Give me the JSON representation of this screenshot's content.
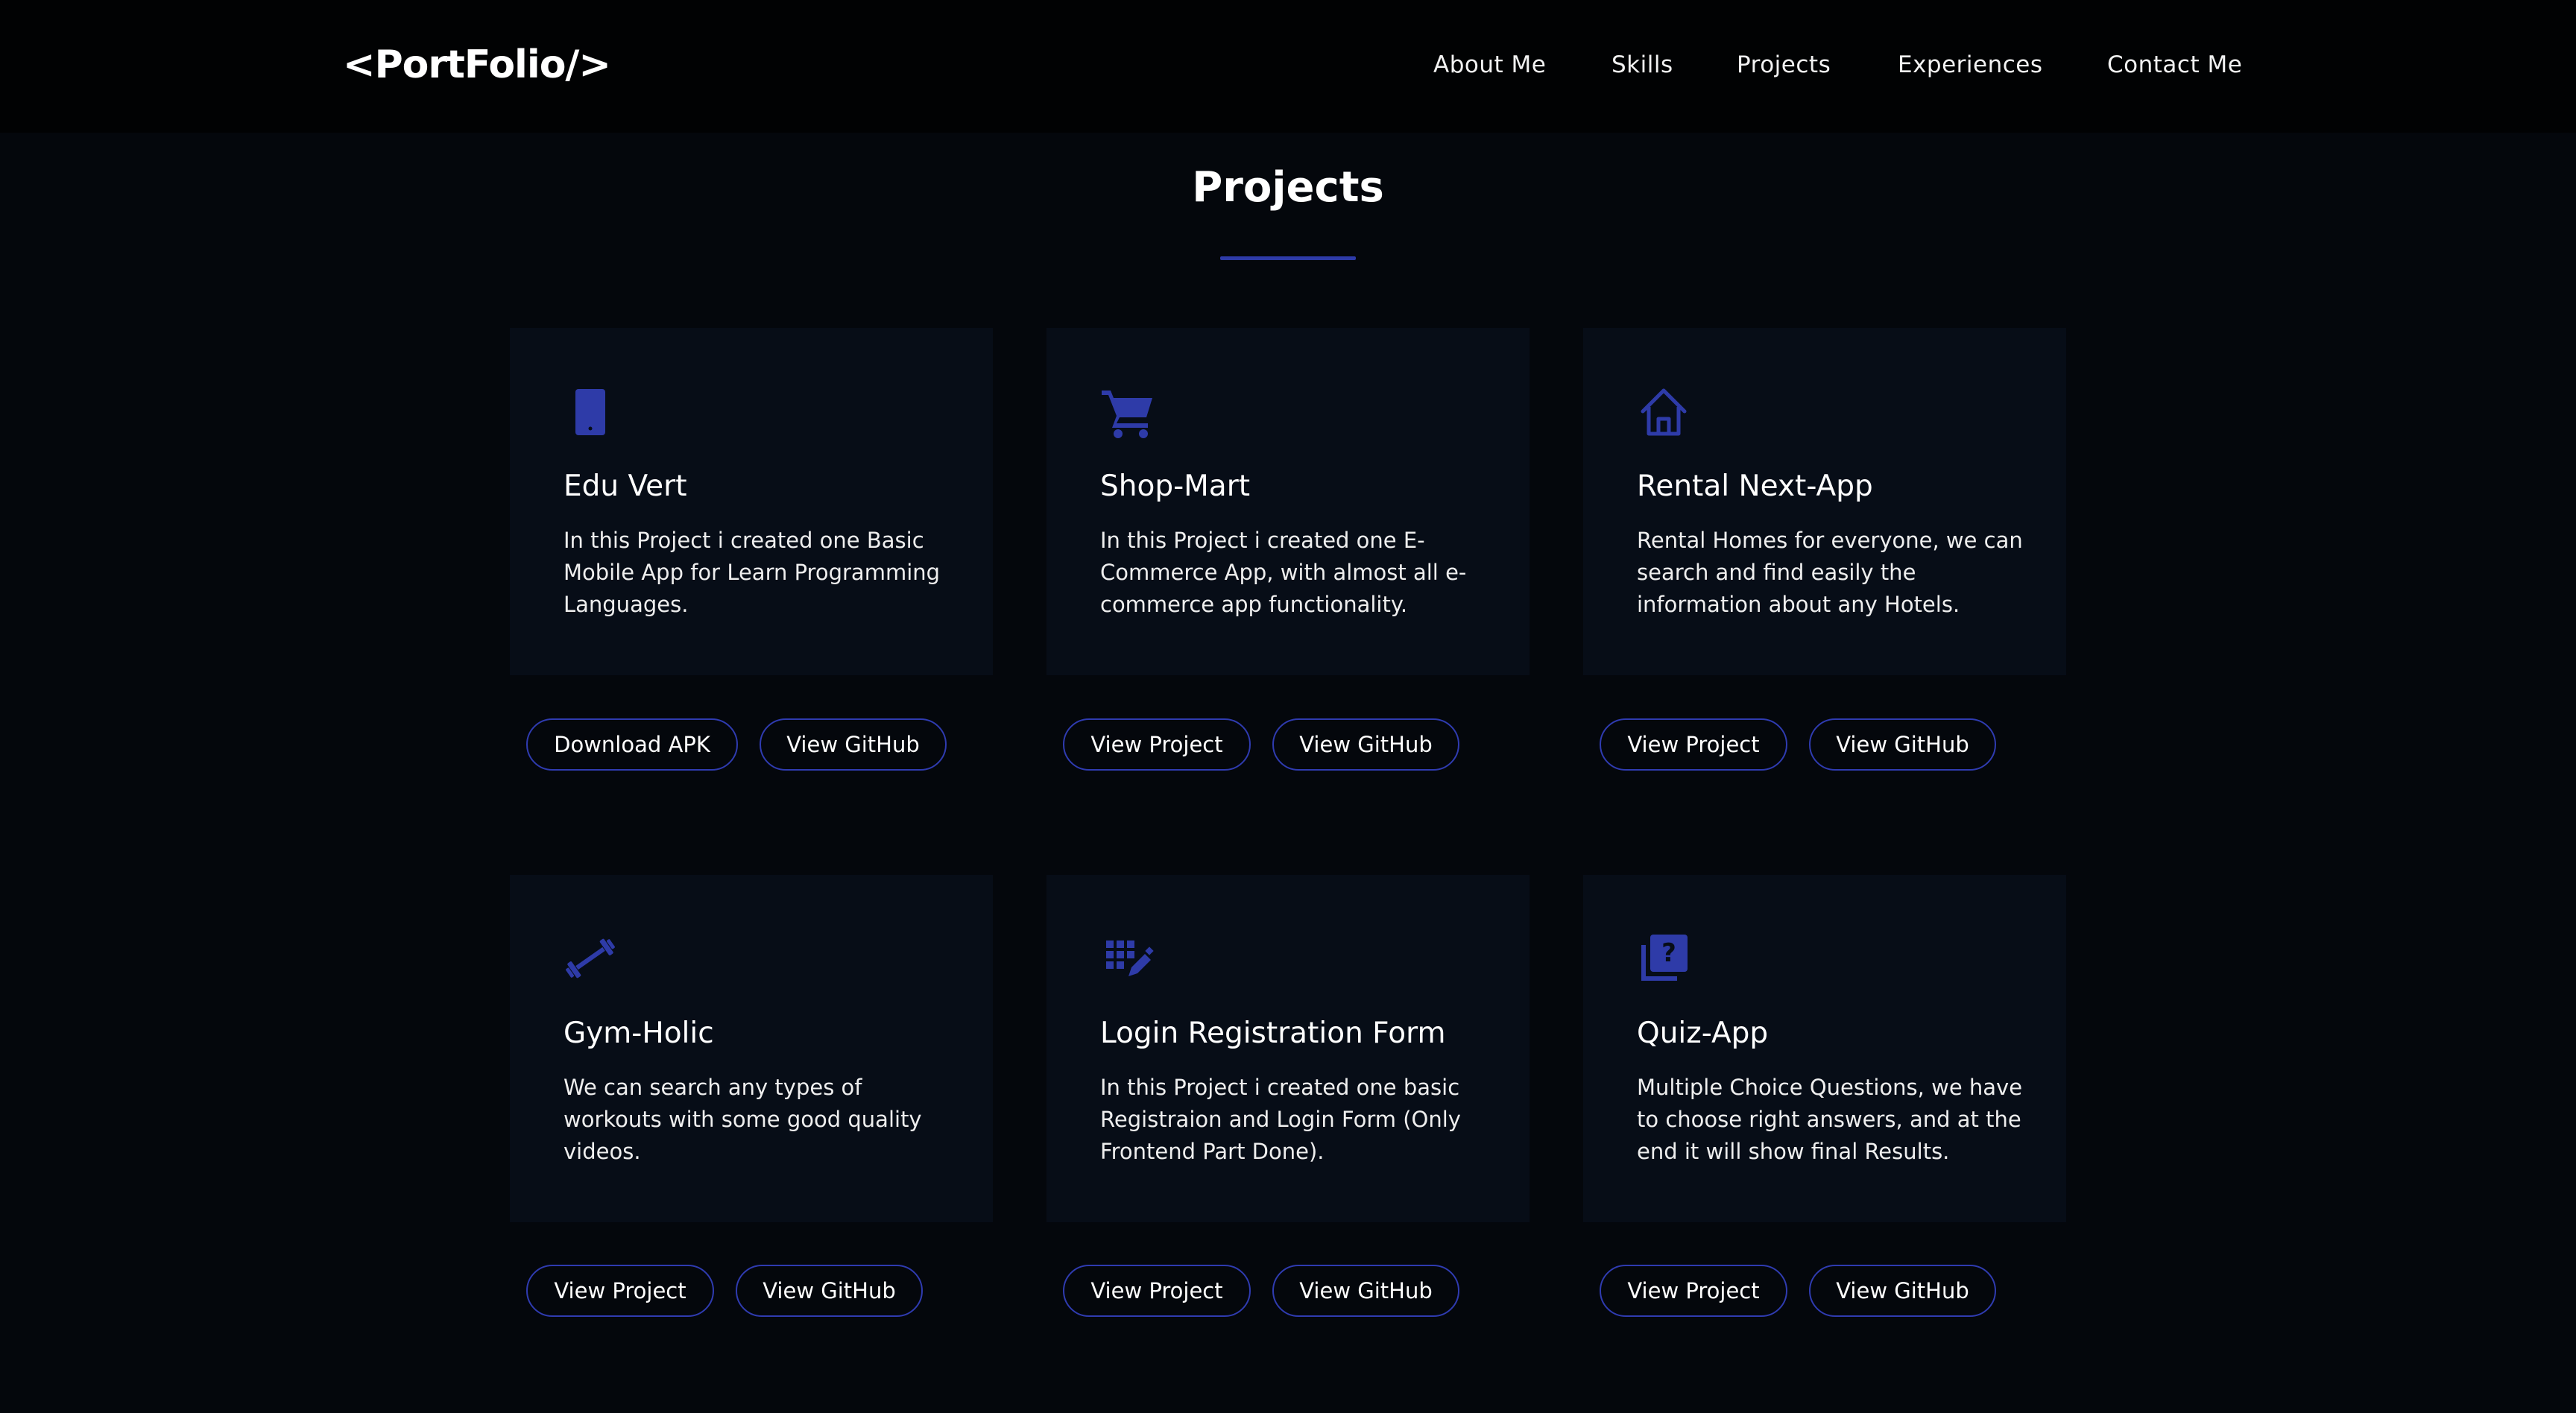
{
  "logo": "<PortFolio/>",
  "nav": {
    "items": [
      {
        "label": "About Me"
      },
      {
        "label": "Skills"
      },
      {
        "label": "Projects"
      },
      {
        "label": "Experiences"
      },
      {
        "label": "Contact Me"
      }
    ]
  },
  "section": {
    "title": "Projects"
  },
  "accent_color": "#2e3ba8",
  "projects": [
    {
      "icon": "mobile-phone-icon",
      "title": "Edu Vert",
      "description": "In this Project i created one Basic Mobile App for Learn Programming Languages.",
      "buttons": [
        "Download APK",
        "View GitHub"
      ]
    },
    {
      "icon": "shopping-cart-icon",
      "title": "Shop-Mart",
      "description": "In this Project i created one E-Commerce App, with almost all e-commerce app functionality.",
      "buttons": [
        "View Project",
        "View GitHub"
      ]
    },
    {
      "icon": "home-icon",
      "title": "Rental Next-App",
      "description": "Rental Homes for everyone, we can search and find easily the information about any Hotels.",
      "buttons": [
        "View Project",
        "View GitHub"
      ]
    },
    {
      "icon": "dumbbell-icon",
      "title": "Gym-Holic",
      "description": "We can search any types of workouts with some good quality videos.",
      "buttons": [
        "View Project",
        "View GitHub"
      ]
    },
    {
      "icon": "form-edit-icon",
      "title": "Login Registration Form",
      "description": "In this Project i created one basic Registraion and Login Form (Only Frontend Part Done).",
      "buttons": [
        "View Project",
        "View GitHub"
      ]
    },
    {
      "icon": "quiz-question-icon",
      "title": "Quiz-App",
      "description": "Multiple Choice Questions, we have to choose right answers, and at the end it will show final Results.",
      "buttons": [
        "View Project",
        "View GitHub"
      ]
    }
  ]
}
